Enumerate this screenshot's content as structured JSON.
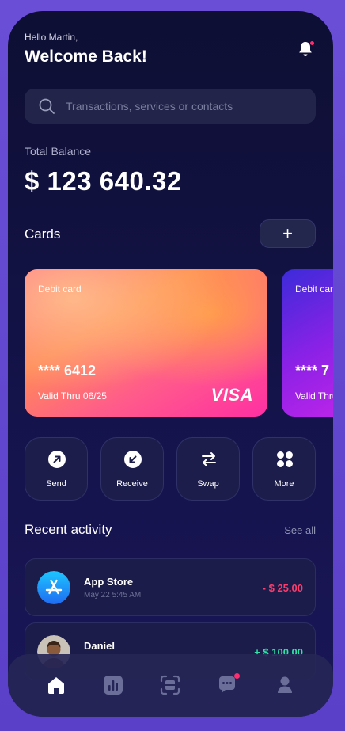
{
  "header": {
    "greeting": "Hello Martin,",
    "title": "Welcome Back!"
  },
  "search": {
    "placeholder": "Transactions, services or contacts",
    "value": ""
  },
  "balance": {
    "label": "Total Balance",
    "value": "$ 123 640.32"
  },
  "cards_section": {
    "title": "Cards",
    "add_label": "+"
  },
  "cards": [
    {
      "type": "Debit card",
      "number": "**** 6412",
      "valid": "Valid Thru 06/25",
      "brand": "VISA"
    },
    {
      "type": "Debit card",
      "number": "**** 7",
      "valid": "Valid Thru",
      "brand": ""
    }
  ],
  "actions": [
    {
      "label": "Send",
      "icon": "arrow-up-right-icon"
    },
    {
      "label": "Receive",
      "icon": "arrow-down-left-icon"
    },
    {
      "label": "Swap",
      "icon": "swap-icon"
    },
    {
      "label": "More",
      "icon": "grid-icon"
    }
  ],
  "recent": {
    "title": "Recent activity",
    "see_all": "See all",
    "items": [
      {
        "name": "App Store",
        "date": "May 22 5:45 AM",
        "amount": "- $ 25.00",
        "status": "negative"
      },
      {
        "name": "Daniel",
        "date": "",
        "amount": "+ $ 100.00",
        "status": "positive"
      }
    ]
  },
  "nav": [
    "home-icon",
    "stats-icon",
    "scan-icon",
    "chat-icon",
    "profile-icon"
  ],
  "colors": {
    "accent_negative": "#ff3b6b",
    "accent_positive": "#2fe2a5",
    "notification": "#ff2d6f"
  }
}
